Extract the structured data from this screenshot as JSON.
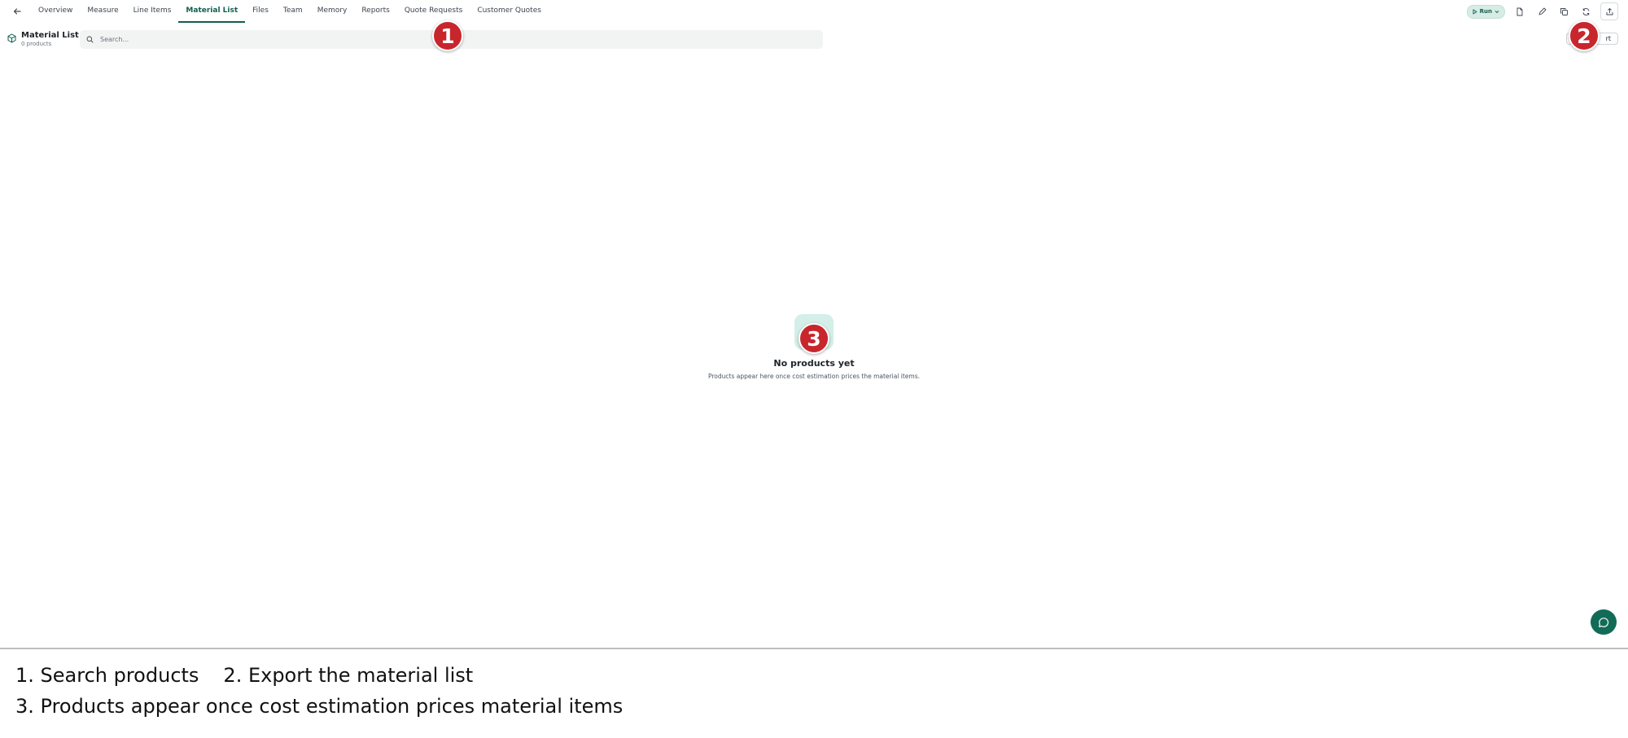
{
  "nav": {
    "tabs": [
      {
        "label": "Overview",
        "active": false
      },
      {
        "label": "Measure",
        "active": false
      },
      {
        "label": "Line Items",
        "active": false
      },
      {
        "label": "Material List",
        "active": true
      },
      {
        "label": "Files",
        "active": false
      },
      {
        "label": "Team",
        "active": false
      },
      {
        "label": "Memory",
        "active": false
      },
      {
        "label": "Reports",
        "active": false
      },
      {
        "label": "Quote Requests",
        "active": false
      },
      {
        "label": "Customer Quotes",
        "active": false
      }
    ],
    "run_label": "Run",
    "action_icons": [
      "document-icon",
      "edit-icon",
      "duplicate-icon",
      "refresh-icon",
      "share-icon"
    ]
  },
  "header": {
    "title": "Material List",
    "subtitle": "0 products",
    "icon": "box-icon"
  },
  "search": {
    "placeholder": "Search..."
  },
  "export": {
    "label": "rt"
  },
  "empty_state": {
    "title": "No products yet",
    "description": "Products appear here once cost estimation prices the material items."
  },
  "markers": [
    "1",
    "2",
    "3"
  ],
  "legend": {
    "line1_a": "1. Search products",
    "line1_b": "2. Export the material list",
    "line2": "3. Products appear once cost estimation prices material items"
  },
  "colors": {
    "accent": "#0f5f4e",
    "marker": "#c8262d",
    "empty_icon_bg": "#d4efe8",
    "fab": "#126b57"
  }
}
